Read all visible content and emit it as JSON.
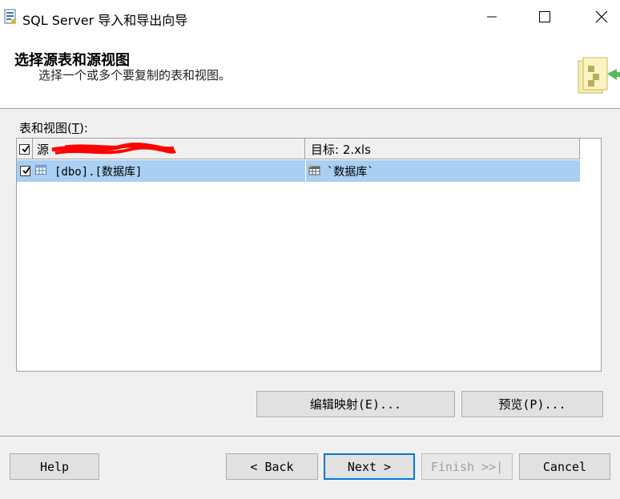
{
  "window": {
    "title": "SQL Server 导入和导出向导",
    "icon": "wizard-app-icon",
    "controls": [
      "minimize-icon",
      "maximize-icon",
      "close-icon"
    ]
  },
  "header": {
    "title": "选择源表和源视图",
    "subtitle": "选择一个或多个要复制的表和视图。",
    "graphic": "wizard-graphic-icon"
  },
  "tables": {
    "label_prefix": "表和视图(",
    "label_mnemonic": "T",
    "label_suffix": "):",
    "columns": {
      "source": "源",
      "destination": "目标: 2.xls"
    },
    "rows": [
      {
        "checked": true,
        "source": "[dbo].[数据库]",
        "destination": "`数据库`",
        "selected": true
      }
    ]
  },
  "buttons": {
    "edit_mappings": "编辑映射(E)...",
    "preview": "预览(P)...",
    "help": "Help",
    "back": "< Back",
    "next": "Next >",
    "finish": "Finish >>|",
    "cancel": "Cancel"
  },
  "colors": {
    "selected_row": "#a9cff2",
    "focus_border": "#0078d7",
    "redaction": "#ff0000"
  }
}
